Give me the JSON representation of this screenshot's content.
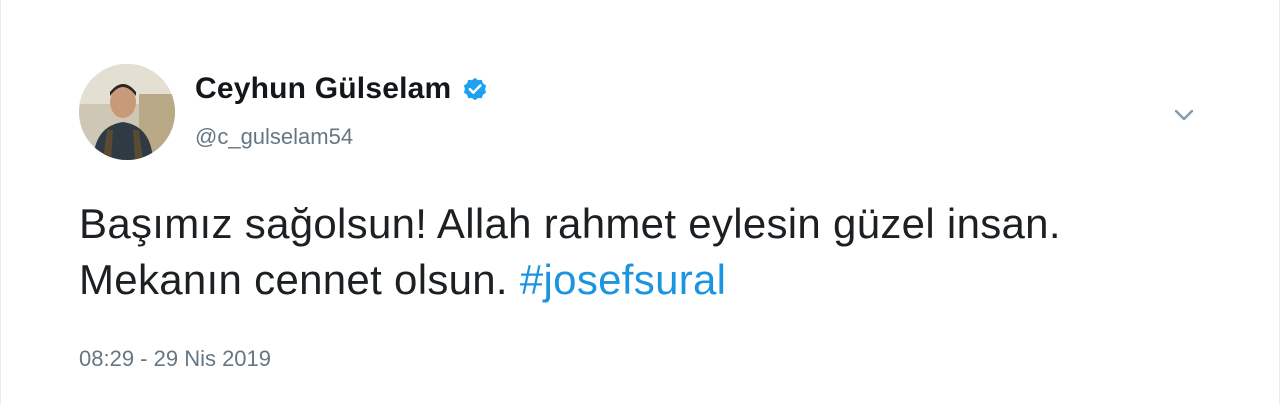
{
  "tweet": {
    "author": {
      "display_name": "Ceyhun Gülselam",
      "handle": "@c_gulselam54",
      "verified": true,
      "avatar_icon": "profile-photo"
    },
    "text_part1": "Başımız sağolsun! Allah rahmet eylesin güzel insan. Mekanın cennet olsun.",
    "hashtag": "#josefsural",
    "timestamp": "08:29 - 29 Nis 2019",
    "menu_icon": "chevron-down-icon"
  },
  "colors": {
    "link": "#1b95e0",
    "verified_badge": "#1da1f2",
    "secondary_text": "#657786",
    "primary_text": "#1c2022"
  }
}
